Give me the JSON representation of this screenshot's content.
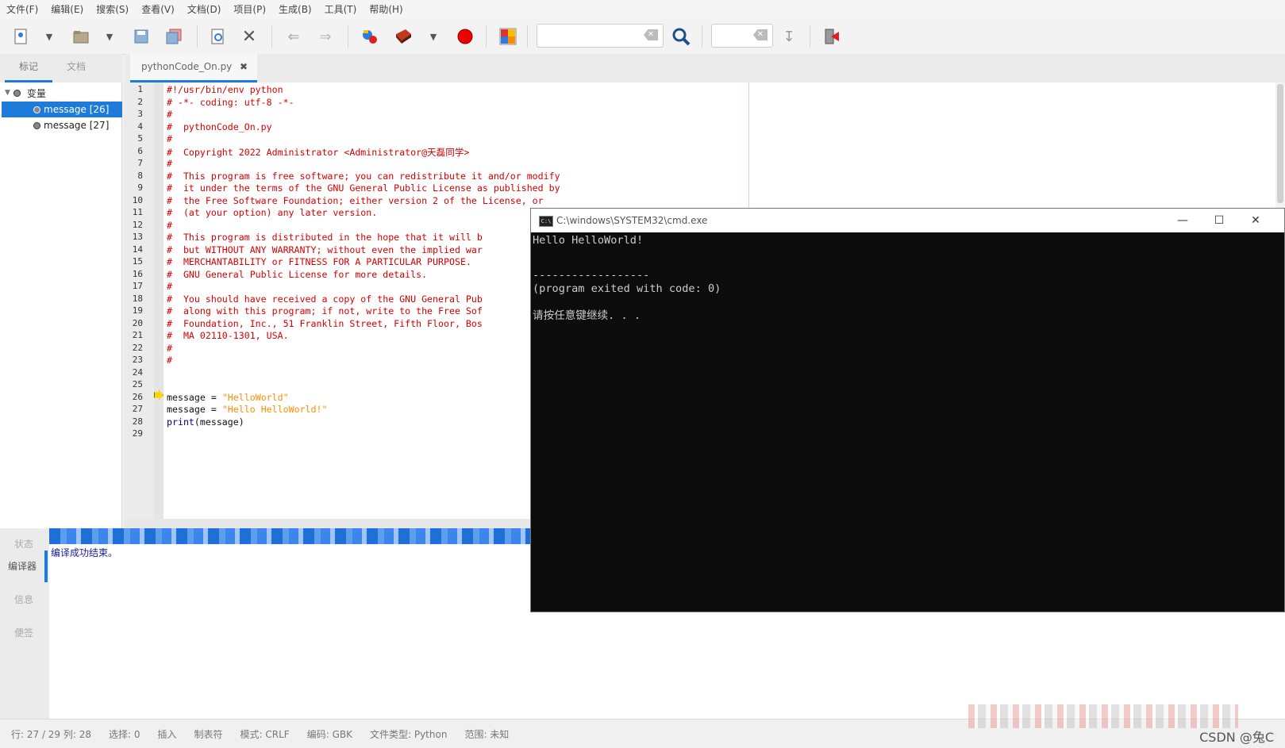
{
  "menu": [
    "文件(F)",
    "编辑(E)",
    "搜索(S)",
    "查看(V)",
    "文档(D)",
    "项目(P)",
    "生成(B)",
    "工具(T)",
    "帮助(H)"
  ],
  "sidebar": {
    "tabs": [
      "标记",
      "文档"
    ],
    "group": "变量",
    "items": [
      "message [26]",
      "message [27]"
    ]
  },
  "editor": {
    "tab_label": "pythonCode_On.py",
    "close_glyph": "✖",
    "line_numbers": [
      "1",
      "2",
      "3",
      "4",
      "5",
      "6",
      "7",
      "8",
      "9",
      "10",
      "11",
      "12",
      "13",
      "14",
      "15",
      "16",
      "17",
      "18",
      "19",
      "20",
      "21",
      "22",
      "23",
      "24",
      "25",
      "26",
      "27",
      "28",
      "29"
    ],
    "comment_lines": [
      "#!/usr/bin/env python",
      "# -*- coding: utf-8 -*-",
      "#",
      "#  pythonCode_On.py",
      "#",
      "#  Copyright 2022 Administrator <Administrator@天磊同学>",
      "#",
      "#  This program is free software; you can redistribute it and/or modify",
      "#  it under the terms of the GNU General Public License as published by",
      "#  the Free Software Foundation; either version 2 of the License, or",
      "#  (at your option) any later version.",
      "#",
      "#  This program is distributed in the hope that it will b",
      "#  but WITHOUT ANY WARRANTY; without even the implied war",
      "#  MERCHANTABILITY or FITNESS FOR A PARTICULAR PURPOSE.",
      "#  GNU General Public License for more details.",
      "#",
      "#  You should have received a copy of the GNU General Pub",
      "#  along with this program; if not, write to the Free Sof",
      "#  Foundation, Inc., 51 Franklin Street, Fifth Floor, Bos",
      "#  MA 02110-1301, USA.",
      "#",
      "#"
    ],
    "line26": {
      "name": "message",
      "op": " = ",
      "value": "\"HelloWorld\""
    },
    "line27": {
      "name": "message",
      "op": " = ",
      "value": "\"Hello HelloWorld!\""
    },
    "line28": {
      "fn": "print",
      "args": "(message)"
    }
  },
  "messages": {
    "tabs": [
      "状态",
      "编译器",
      "信息",
      "便签"
    ],
    "line": "编译成功结束。"
  },
  "cmd": {
    "title": "C:\\windows\\SYSTEM32\\cmd.exe",
    "icon_text": "C:\\",
    "lines": [
      "Hello HelloWorld!",
      "",
      "------------------",
      "(program exited with code: 0)",
      "",
      "请按任意键继续. . ."
    ]
  },
  "status": [
    "行: 27 / 29  列: 28",
    "选择: 0",
    "插入",
    "制表符",
    "模式: CRLF",
    "编码: GBK",
    "文件类型: Python",
    "范围: 未知"
  ],
  "watermark": "CSDN @兔C",
  "icons": [
    "new-file-icon",
    "open-folder-icon",
    "save-icon",
    "save-all-icon",
    "reload-icon",
    "close-file-icon",
    "back-icon",
    "forward-icon",
    "compile-icon",
    "build-icon",
    "stop-icon",
    "color-picker-icon",
    "search-icon",
    "jump-line-icon",
    "exit-icon"
  ]
}
